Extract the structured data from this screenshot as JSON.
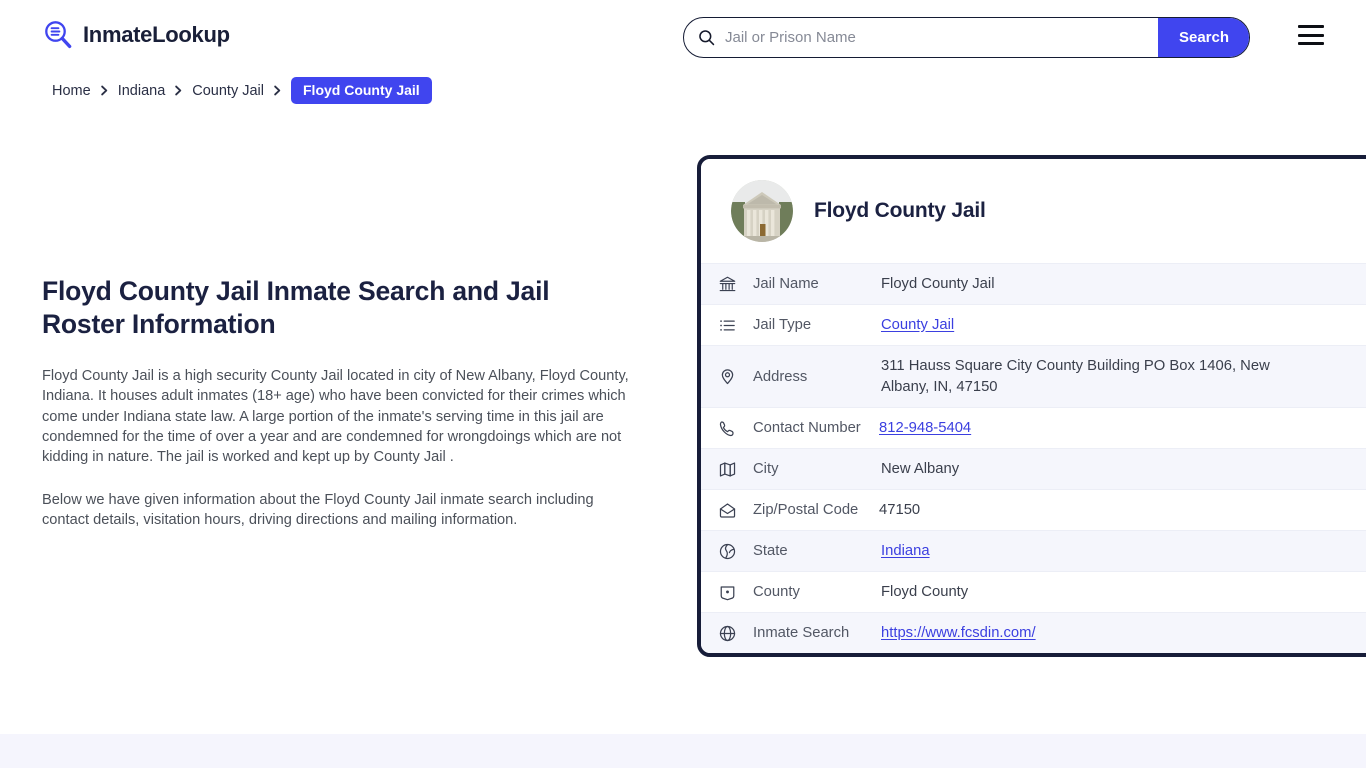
{
  "header": {
    "brand_name": "InmateLookup",
    "logo_icon": "magnifier-list-icon",
    "menu_icon": "hamburger-menu-icon",
    "accent_color": "#4045ef",
    "dark_color": "#171d39"
  },
  "search": {
    "icon": "search-icon",
    "placeholder": "Jail or Prison Name",
    "value": "",
    "button_label": "Search"
  },
  "breadcrumb": {
    "items": [
      {
        "label": "Home",
        "current": false
      },
      {
        "label": "Indiana",
        "current": false
      },
      {
        "label": "County Jail",
        "current": false
      },
      {
        "label": "Floyd County Jail",
        "current": true
      }
    ]
  },
  "main": {
    "title": "Floyd County Jail Inmate Search and Jail Roster Information",
    "paragraph_1": "Floyd County Jail is a high security County Jail located in city of New Albany, Floyd County, Indiana. It houses adult inmates (18+ age) who have been convicted for their crimes which come under Indiana state law. A large portion of the inmate's serving time in this jail are condemned for the time of over a year and are condemned for wrongdoings which are not kidding in nature. The jail is worked and kept up by County Jail .",
    "paragraph_2": "Below we have given information about the Floyd County Jail inmate search including contact details, visitation hours, driving directions and mailing information."
  },
  "card": {
    "avatar_icon": "courthouse-building-photo",
    "title": "Floyd County Jail",
    "rows": [
      {
        "icon": "bank-icon",
        "label": "Jail Name",
        "value": "Floyd County Jail",
        "link": false
      },
      {
        "icon": "list-icon",
        "label": "Jail Type",
        "value": "County Jail",
        "link": true
      },
      {
        "icon": "map-pin-icon",
        "label": "Address",
        "value": "311 Hauss Square City County Building PO Box 1406, New Albany, IN, 47150",
        "link": false
      },
      {
        "icon": "phone-icon",
        "label": "Contact Number",
        "value": "812-948-5404",
        "link": true
      },
      {
        "icon": "map-icon",
        "label": "City",
        "value": "New Albany",
        "link": false
      },
      {
        "icon": "envelope-icon",
        "label": "Zip/Postal Code",
        "value": "47150",
        "link": false
      },
      {
        "icon": "globe-shield-icon",
        "label": "State",
        "value": "Indiana",
        "link": true
      },
      {
        "icon": "badge-flag-icon",
        "label": "County",
        "value": "Floyd County",
        "link": false
      },
      {
        "icon": "globe-icon",
        "label": "Inmate Search",
        "value": "https://www.fcsdin.com/",
        "link": true
      }
    ]
  }
}
